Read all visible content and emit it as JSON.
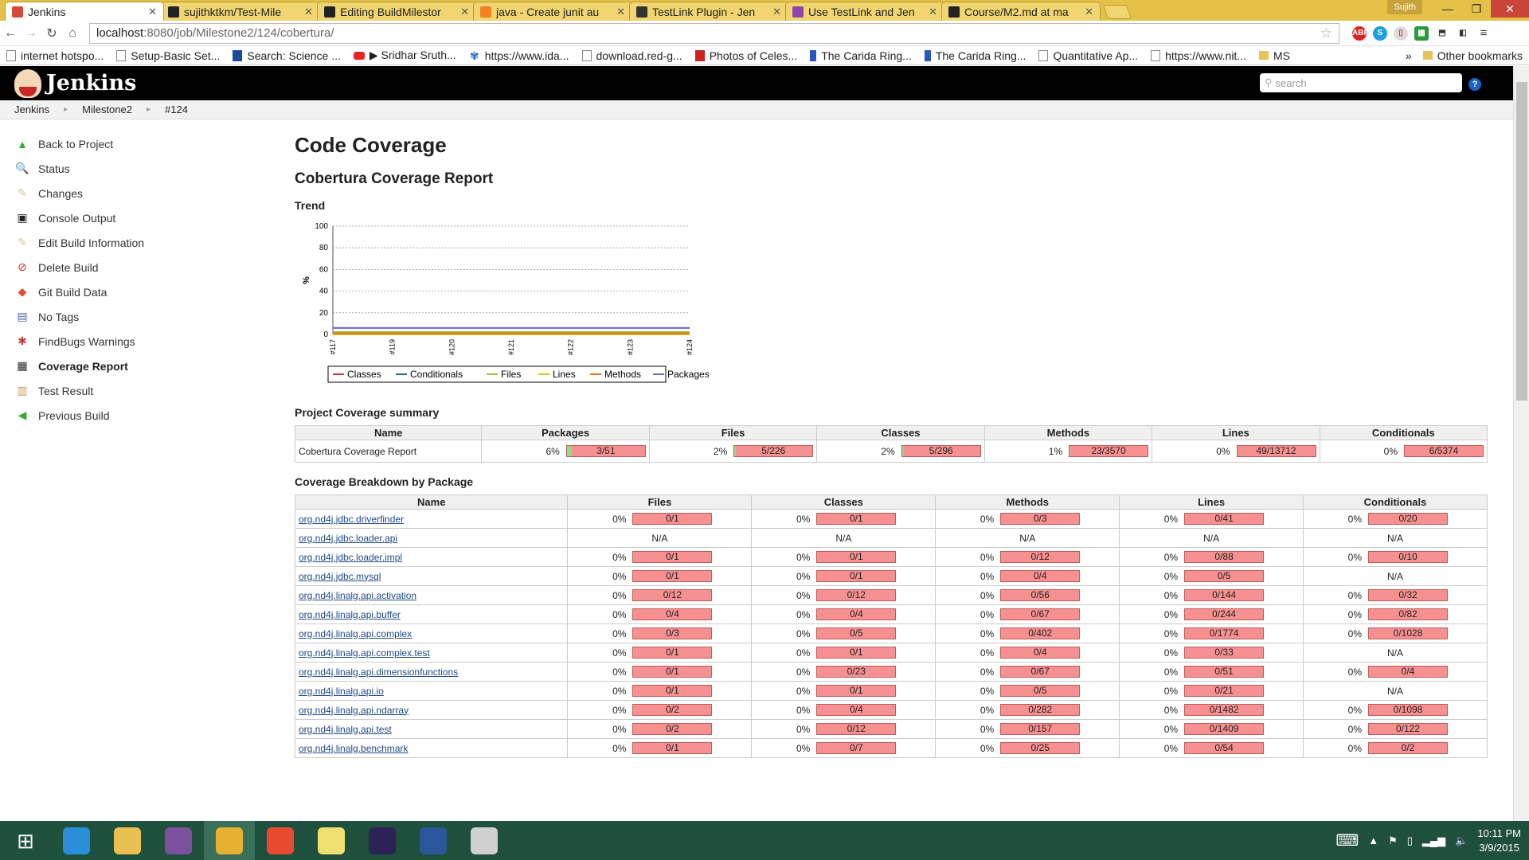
{
  "browser": {
    "tabs": [
      {
        "title": "Jenkins",
        "active": true,
        "icon_color": "#d44a3a"
      },
      {
        "title": "sujithktkm/Test-Mile",
        "active": false,
        "icon_color": "#222222"
      },
      {
        "title": "Editing BuildMilestor",
        "active": false,
        "icon_color": "#222222"
      },
      {
        "title": "java - Create junit au",
        "active": false,
        "icon_color": "#f48024"
      },
      {
        "title": "TestLink Plugin - Jen",
        "active": false,
        "icon_color": "#333333"
      },
      {
        "title": "Use TestLink and Jen",
        "active": false,
        "icon_color": "#8e44ad"
      },
      {
        "title": "Course/M2.md at ma",
        "active": false,
        "icon_color": "#222222"
      }
    ],
    "user": "Sujith",
    "url_host": "localhost",
    "url_path": ":8080/job/Milestone2/124/cobertura/",
    "bookmarks": [
      {
        "label": "internet hotspo...",
        "icon": "page"
      },
      {
        "label": "Setup-Basic Set...",
        "icon": "page"
      },
      {
        "label": "Search: Science ...",
        "icon": "usa"
      },
      {
        "label": "▶ Sridhar Sruth...",
        "icon": "yt"
      },
      {
        "label": "https://www.ida...",
        "icon": "flower"
      },
      {
        "label": "download.red-g...",
        "icon": "page"
      },
      {
        "label": "Photos of Celes...",
        "icon": "red"
      },
      {
        "label": "The Carida Ring...",
        "icon": "blue"
      },
      {
        "label": "The Carida Ring...",
        "icon": "blue"
      },
      {
        "label": "Quantitative Ap...",
        "icon": "page"
      },
      {
        "label": "https://www.nit...",
        "icon": "page"
      },
      {
        "label": "MS",
        "icon": "folder"
      }
    ],
    "bookmarks_more": "»",
    "other_bookmarks": "Other bookmarks"
  },
  "jenkins": {
    "logo": "Jenkins",
    "search_placeholder": "search",
    "help": "?",
    "breadcrumb": [
      "Jenkins",
      "Milestone2",
      "#124"
    ],
    "sidebar": [
      {
        "label": "Back to Project",
        "icon": "arrow-up-icon",
        "color": "#3aa83a",
        "glyph": "▲"
      },
      {
        "label": "Status",
        "icon": "magnifier-icon",
        "color": "#8fb3d9",
        "glyph": "🔍"
      },
      {
        "label": "Changes",
        "icon": "notepad-icon",
        "color": "#d8c89a",
        "glyph": "✎"
      },
      {
        "label": "Console Output",
        "icon": "terminal-icon",
        "color": "#222222",
        "glyph": "▣"
      },
      {
        "label": "Edit Build Information",
        "icon": "pencil-icon",
        "color": "#d8c89a",
        "glyph": "✎"
      },
      {
        "label": "Delete Build",
        "icon": "no-entry-icon",
        "color": "#d22222",
        "glyph": "⊘"
      },
      {
        "label": "Git Build Data",
        "icon": "git-icon",
        "color": "#e8482f",
        "glyph": "◆"
      },
      {
        "label": "No Tags",
        "icon": "floppy-icon",
        "color": "#4a6aa8",
        "glyph": "▤"
      },
      {
        "label": "FindBugs Warnings",
        "icon": "bug-icon",
        "color": "#c43b3b",
        "glyph": "✱"
      },
      {
        "label": "Coverage Report",
        "icon": "coverage-icon",
        "color": "#666666",
        "glyph": "▦",
        "active": true
      },
      {
        "label": "Test Result",
        "icon": "clipboard-icon",
        "color": "#c8a060",
        "glyph": "▥"
      },
      {
        "label": "Previous Build",
        "icon": "arrow-left-icon",
        "color": "#3aa83a",
        "glyph": "◀"
      }
    ]
  },
  "page": {
    "title": "Code Coverage",
    "subtitle": "Cobertura Coverage Report",
    "trend_heading": "Trend",
    "summary_heading": "Project Coverage summary",
    "breakdown_heading": "Coverage Breakdown by Package"
  },
  "chart_data": {
    "type": "line",
    "title": "",
    "ylabel": "%",
    "xlabel": "",
    "ylim": [
      0,
      100
    ],
    "yticks": [
      0,
      20,
      40,
      60,
      80,
      100
    ],
    "grid": true,
    "legend_position": "bottom",
    "x": [
      "#117",
      "#119",
      "#120",
      "#121",
      "#122",
      "#123",
      "#124"
    ],
    "series": [
      {
        "name": "Classes",
        "color": "#cc3333",
        "values": [
          2,
          2,
          2,
          2,
          2,
          2,
          2
        ]
      },
      {
        "name": "Conditionals",
        "color": "#33668f",
        "values": [
          0,
          0,
          0,
          0,
          0,
          0,
          0
        ]
      },
      {
        "name": "Files",
        "color": "#88cc33",
        "values": [
          2,
          2,
          2,
          2,
          2,
          2,
          2
        ]
      },
      {
        "name": "Lines",
        "color": "#e0c020",
        "values": [
          0,
          0,
          0,
          0,
          0,
          0,
          0
        ]
      },
      {
        "name": "Methods",
        "color": "#e87020",
        "values": [
          1,
          1,
          1,
          1,
          1,
          1,
          1
        ]
      },
      {
        "name": "Packages",
        "color": "#6666cc",
        "values": [
          6,
          6,
          6,
          6,
          6,
          6,
          6
        ]
      }
    ]
  },
  "summary": {
    "columns": [
      "Name",
      "Packages",
      "Files",
      "Classes",
      "Methods",
      "Lines",
      "Conditionals"
    ],
    "row": {
      "name": "Cobertura Coverage Report",
      "cells": [
        {
          "pct": "6%",
          "ratio": "3/51",
          "fill": 0.06
        },
        {
          "pct": "2%",
          "ratio": "5/226",
          "fill": 0.02
        },
        {
          "pct": "2%",
          "ratio": "5/296",
          "fill": 0.02
        },
        {
          "pct": "1%",
          "ratio": "23/3570",
          "fill": 0.01
        },
        {
          "pct": "0%",
          "ratio": "49/13712",
          "fill": 0.0
        },
        {
          "pct": "0%",
          "ratio": "6/5374",
          "fill": 0.0
        }
      ]
    }
  },
  "breakdown": {
    "columns": [
      "Name",
      "Files",
      "Classes",
      "Methods",
      "Lines",
      "Conditionals"
    ],
    "rows": [
      {
        "name": "org.nd4j.jdbc.driverfinder",
        "cells": [
          "0/1",
          "0/1",
          "0/3",
          "0/41",
          "0/20"
        ]
      },
      {
        "name": "org.nd4j.jdbc.loader.api",
        "cells": [
          "N/A",
          "N/A",
          "N/A",
          "N/A",
          "N/A"
        ]
      },
      {
        "name": "org.nd4j.jdbc.loader.impl",
        "cells": [
          "0/1",
          "0/1",
          "0/12",
          "0/88",
          "0/10"
        ]
      },
      {
        "name": "org.nd4j.jdbc.mysql",
        "cells": [
          "0/1",
          "0/1",
          "0/4",
          "0/5",
          "N/A"
        ]
      },
      {
        "name": "org.nd4j.linalg.api.activation",
        "cells": [
          "0/12",
          "0/12",
          "0/56",
          "0/144",
          "0/32"
        ]
      },
      {
        "name": "org.nd4j.linalg.api.buffer",
        "cells": [
          "0/4",
          "0/4",
          "0/67",
          "0/244",
          "0/82"
        ]
      },
      {
        "name": "org.nd4j.linalg.api.complex",
        "cells": [
          "0/3",
          "0/5",
          "0/402",
          "0/1774",
          "0/1028"
        ]
      },
      {
        "name": "org.nd4j.linalg.api.complex.test",
        "cells": [
          "0/1",
          "0/1",
          "0/4",
          "0/33",
          "N/A"
        ]
      },
      {
        "name": "org.nd4j.linalg.api.dimensionfunctions",
        "cells": [
          "0/1",
          "0/23",
          "0/67",
          "0/51",
          "0/4"
        ]
      },
      {
        "name": "org.nd4j.linalg.api.io",
        "cells": [
          "0/1",
          "0/1",
          "0/5",
          "0/21",
          "N/A"
        ]
      },
      {
        "name": "org.nd4j.linalg.api.ndarray",
        "cells": [
          "0/2",
          "0/4",
          "0/282",
          "0/1482",
          "0/1098"
        ]
      },
      {
        "name": "org.nd4j.linalg.api.test",
        "cells": [
          "0/2",
          "0/12",
          "0/157",
          "0/1409",
          "0/122"
        ]
      },
      {
        "name": "org.nd4j.linalg.benchmark",
        "cells": [
          "0/1",
          "0/7",
          "0/25",
          "0/54",
          "0/2"
        ]
      }
    ],
    "zero_pct": "0%"
  },
  "taskbar": {
    "apps": [
      {
        "name": "windows-start-icon",
        "color": "#ffffff"
      },
      {
        "name": "internet-explorer-icon",
        "color": "#2a8fd8"
      },
      {
        "name": "file-explorer-icon",
        "color": "#e8c050"
      },
      {
        "name": "viber-icon",
        "color": "#7b519d"
      },
      {
        "name": "chrome-icon",
        "color": "#e8b030",
        "active": true
      },
      {
        "name": "git-icon",
        "color": "#e84a2f"
      },
      {
        "name": "sticky-notes-icon",
        "color": "#f0e070"
      },
      {
        "name": "eclipse-icon",
        "color": "#2c2255"
      },
      {
        "name": "word-icon",
        "color": "#2b579a"
      },
      {
        "name": "paint-icon",
        "color": "#d0d0d0"
      }
    ],
    "time": "10:11 PM",
    "date": "3/9/2015"
  }
}
